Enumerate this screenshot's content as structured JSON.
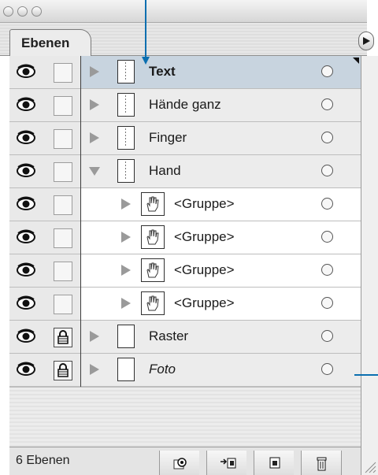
{
  "window": {
    "tab_label": "Ebenen"
  },
  "layers": [
    {
      "name": "Text",
      "style": "bold",
      "selected": true,
      "expanded": false,
      "child": false,
      "locked": false,
      "thumb": "dots"
    },
    {
      "name": "Hände ganz",
      "style": "normal",
      "selected": false,
      "expanded": false,
      "child": false,
      "locked": false,
      "thumb": "dots"
    },
    {
      "name": "Finger",
      "style": "normal",
      "selected": false,
      "expanded": false,
      "child": false,
      "locked": false,
      "thumb": "dots"
    },
    {
      "name": "Hand",
      "style": "normal",
      "selected": false,
      "expanded": true,
      "child": false,
      "locked": false,
      "thumb": "dots"
    },
    {
      "name": "<Gruppe>",
      "style": "normal",
      "selected": false,
      "expanded": false,
      "child": true,
      "locked": false,
      "thumb": "hand"
    },
    {
      "name": "<Gruppe>",
      "style": "normal",
      "selected": false,
      "expanded": false,
      "child": true,
      "locked": false,
      "thumb": "hand"
    },
    {
      "name": "<Gruppe>",
      "style": "normal",
      "selected": false,
      "expanded": false,
      "child": true,
      "locked": false,
      "thumb": "hand"
    },
    {
      "name": "<Gruppe>",
      "style": "normal",
      "selected": false,
      "expanded": false,
      "child": true,
      "locked": false,
      "thumb": "hand"
    },
    {
      "name": "Raster",
      "style": "normal",
      "selected": false,
      "expanded": false,
      "child": false,
      "locked": true,
      "thumb": "plain"
    },
    {
      "name": "Foto",
      "style": "italic",
      "selected": false,
      "expanded": false,
      "child": false,
      "locked": true,
      "thumb": "plain"
    }
  ],
  "footer": {
    "count_label": "6 Ebenen",
    "buttons": [
      "locate-object-icon",
      "make-clipping-mask-icon",
      "new-layer-icon",
      "trash-icon"
    ]
  },
  "colors": {
    "selected_row": "#c8d4df",
    "callout": "#0b6fb0"
  }
}
